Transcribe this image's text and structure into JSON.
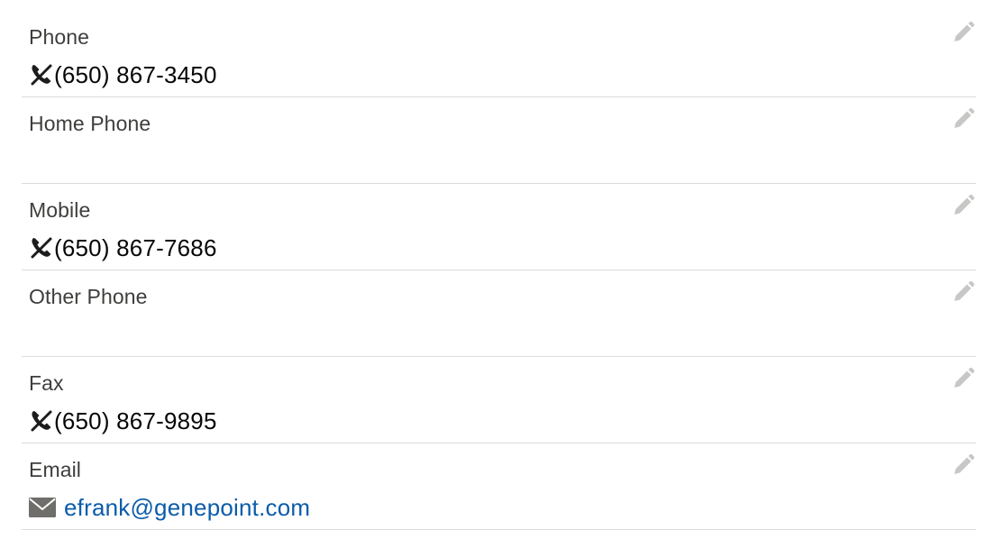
{
  "fields": [
    {
      "label": "Phone",
      "value": "(650) 867-3450",
      "icon": "phone-icon",
      "type": "phone"
    },
    {
      "label": "Home Phone",
      "value": "",
      "type": "phone"
    },
    {
      "label": "Mobile",
      "value": "(650) 867-7686",
      "icon": "phone-icon",
      "type": "phone"
    },
    {
      "label": "Other Phone",
      "value": "",
      "type": "phone"
    },
    {
      "label": "Fax",
      "value": "(650) 867-9895",
      "icon": "phone-icon",
      "type": "phone"
    },
    {
      "label": "Email",
      "value": "efrank@genepoint.com",
      "icon": "email-icon",
      "type": "email"
    }
  ],
  "colors": {
    "label": "#3e3e3c",
    "value": "#080707",
    "link": "#0b5cab",
    "divider": "#dddbda",
    "edit_icon": "#c9c7c5"
  },
  "edit_icon": "pencil-icon"
}
